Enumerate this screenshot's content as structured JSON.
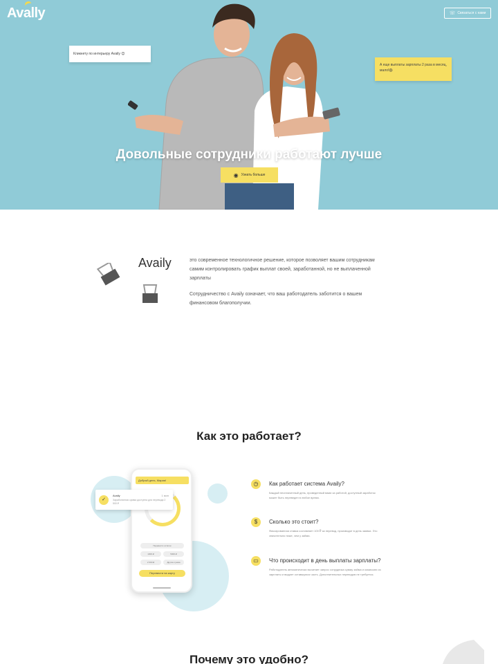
{
  "header": {
    "logo": "Avally",
    "logo_sub": "",
    "contact_label": "Связаться с нами",
    "phone_icon": "phone-icon"
  },
  "hero": {
    "title": "Довольные сотрудники работают лучше",
    "button_label": "Узнать больше",
    "button_icon": "eye-icon",
    "bubble_left": "Кликнету по интерьеру Availy 😊",
    "bubble_right": "А еще выплаты зарплаты 2 раза в месяц, мало!😱"
  },
  "about": {
    "brand": "Availy",
    "paragraph1": "это современное технологичное решение, которое позволяет вашим сотрудникам самим контролировать график выплат своей, заработанной, но не выплаченной зарплаты",
    "paragraph2": "Сотрудничество с Availy означает, что ваш работодатель заботится о вашем финансовом благополучии."
  },
  "how": {
    "title": "Как это работает?",
    "phone": {
      "header": "Добрый день, Мария!",
      "amount": "",
      "row1": "Перевести остаток",
      "row2a": "1000 ₽",
      "row2b": "5000 ₽",
      "row3a": "2 000 ₽",
      "row3b": "Другая сумма",
      "pay": "Перевести на карту"
    },
    "notification": {
      "title": "Availy",
      "time": "1 мин",
      "text": "Заработанная сумма доступна для перевода 2 500 ₽"
    },
    "faq": [
      {
        "icon": "clock-icon",
        "q": "Как работает система Availy?",
        "a": "Каждый неоплаченный день, проведенный вами за работой, доступный заработок может быть переведен в любое время."
      },
      {
        "icon": "dollar-icon",
        "q": "Сколько это стоит?",
        "a": "Фиксированная ставка составляет 100 ₽ за перевод, производит в день заявки. Это значительно ниже, чем у займа."
      },
      {
        "icon": "money-icon",
        "q": "Что происходит в день выплаты зарплаты?",
        "a": "Работодатель автоматически вычитает запрос сотрудника сумму займа и комиссию из зарплаты и выдает оставшуюся часть. Дополнительных переводов не требуется."
      }
    ]
  },
  "why": {
    "title": "Почему это удобно?"
  },
  "colors": {
    "hero_bg": "#90cbd7",
    "accent": "#f6df62",
    "light_circle": "#d7eef3"
  }
}
